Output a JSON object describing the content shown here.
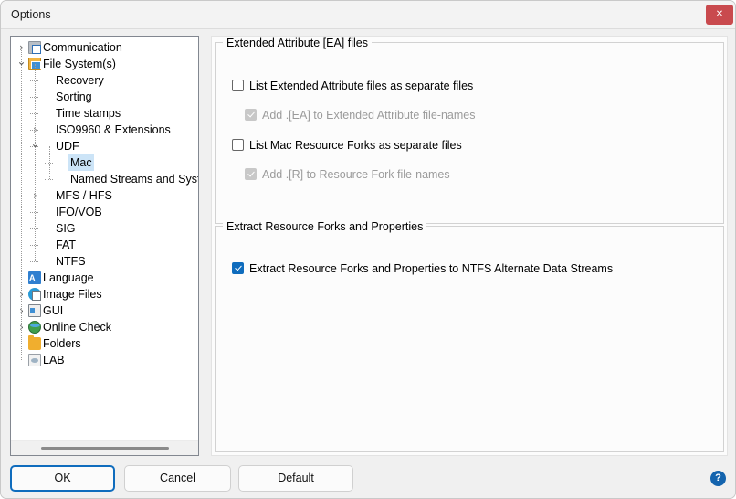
{
  "window": {
    "title": "Options",
    "close_label": "✕"
  },
  "tree": {
    "items": [
      {
        "label": "Communication",
        "indent": 0,
        "chevron": "collapsed",
        "icon": "communication-icon",
        "selected": false
      },
      {
        "label": "File System(s)",
        "indent": 0,
        "chevron": "expanded",
        "icon": "file-systems-icon",
        "selected": false
      },
      {
        "label": "Recovery",
        "indent": 1,
        "chevron": "none",
        "icon": "none",
        "selected": false
      },
      {
        "label": "Sorting",
        "indent": 1,
        "chevron": "none",
        "icon": "none",
        "selected": false
      },
      {
        "label": "Time stamps",
        "indent": 1,
        "chevron": "none",
        "icon": "none",
        "selected": false
      },
      {
        "label": "ISO9960 & Extensions",
        "indent": 1,
        "chevron": "collapsed",
        "icon": "none",
        "selected": false
      },
      {
        "label": "UDF",
        "indent": 1,
        "chevron": "expanded",
        "icon": "none",
        "selected": false
      },
      {
        "label": "Mac",
        "indent": 2,
        "chevron": "none",
        "icon": "none",
        "selected": true
      },
      {
        "label": "Named Streams and System",
        "indent": 2,
        "chevron": "none",
        "icon": "none",
        "selected": false
      },
      {
        "label": "MFS / HFS",
        "indent": 1,
        "chevron": "collapsed",
        "icon": "none",
        "selected": false
      },
      {
        "label": "IFO/VOB",
        "indent": 1,
        "chevron": "none",
        "icon": "none",
        "selected": false
      },
      {
        "label": "SIG",
        "indent": 1,
        "chevron": "none",
        "icon": "none",
        "selected": false
      },
      {
        "label": "FAT",
        "indent": 1,
        "chevron": "none",
        "icon": "none",
        "selected": false
      },
      {
        "label": "NTFS",
        "indent": 1,
        "chevron": "none",
        "icon": "none",
        "selected": false
      },
      {
        "label": "Language",
        "indent": 0,
        "chevron": "none",
        "icon": "language-icon",
        "selected": false
      },
      {
        "label": "Image Files",
        "indent": 0,
        "chevron": "collapsed",
        "icon": "image-files-icon",
        "selected": false
      },
      {
        "label": "GUI",
        "indent": 0,
        "chevron": "collapsed",
        "icon": "gui-icon",
        "selected": false
      },
      {
        "label": "Online Check",
        "indent": 0,
        "chevron": "collapsed",
        "icon": "globe-icon",
        "selected": false
      },
      {
        "label": "Folders",
        "indent": 0,
        "chevron": "none",
        "icon": "folder-icon",
        "selected": false
      },
      {
        "label": "LAB",
        "indent": 0,
        "chevron": "none",
        "icon": "lab-icon",
        "selected": false
      }
    ]
  },
  "content": {
    "ea_group": {
      "title": "Extended Attribute [EA] files",
      "options": [
        {
          "label": "List Extended Attribute files as separate files",
          "checked": false,
          "disabled": false,
          "sub": false
        },
        {
          "label": "Add .[EA] to Extended Attribute file-names",
          "checked": true,
          "disabled": true,
          "sub": true
        },
        {
          "label": "List Mac Resource Forks as separate files",
          "checked": false,
          "disabled": false,
          "sub": false
        },
        {
          "label": "Add .[R] to Resource Fork file-names",
          "checked": true,
          "disabled": true,
          "sub": true
        }
      ]
    },
    "extract_group": {
      "title": "Extract Resource Forks and Properties",
      "options": [
        {
          "label": "Extract Resource Forks and Properties to NTFS Alternate Data Streams",
          "checked": true,
          "disabled": false,
          "sub": false
        }
      ]
    }
  },
  "buttons": {
    "ok": "OK",
    "ok_accel": "O",
    "ok_rest": "K",
    "cancel_accel": "C",
    "cancel_rest": "ancel",
    "default_accel": "D",
    "default_rest": "efault",
    "help": "?"
  },
  "colors": {
    "accent": "#0f6cbd",
    "close_button": "#c94a4e",
    "selection": "#cce4f7",
    "help_button": "#1464ae"
  }
}
